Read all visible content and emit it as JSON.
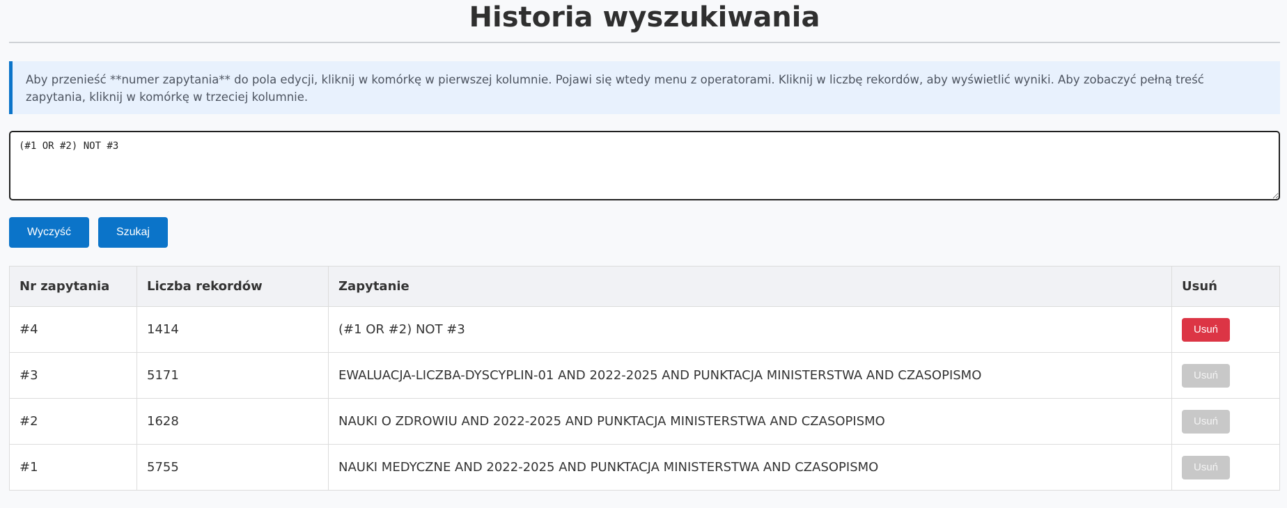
{
  "page": {
    "title": "Historia wyszukiwania",
    "info": "Aby przenieść **numer zapytania** do pola edycji, kliknij w komórkę w pierwszej kolumnie. Pojawi się wtedy menu z operatorami. Kliknij w liczbę rekordów, aby wyświetlić wyniki. Aby zobaczyć pełną treść zapytania, kliknij w komórkę w trzeciej kolumnie."
  },
  "editor": {
    "value": "(#1 OR #2) NOT #3"
  },
  "buttons": {
    "clear_label": "Wyczyść",
    "search_label": "Szukaj"
  },
  "table": {
    "headers": {
      "nr": "Nr zapytania",
      "count": "Liczba rekordów",
      "query": "Zapytanie",
      "delete": "Usuń"
    },
    "rows": [
      {
        "nr": "#4",
        "count": "1414",
        "query": "(#1 OR #2) NOT #3",
        "delete_label": "Usuń",
        "delete_enabled": true
      },
      {
        "nr": "#3",
        "count": "5171",
        "query": "EWALUACJA-LICZBA-DYSCYPLIN-01 AND 2022-2025 AND PUNKTACJA MINISTERSTWA AND CZASOPISMO",
        "delete_label": "Usuń",
        "delete_enabled": false
      },
      {
        "nr": "#2",
        "count": "1628",
        "query": "NAUKI O ZDROWIU AND 2022-2025 AND PUNKTACJA MINISTERSTWA AND CZASOPISMO",
        "delete_label": "Usuń",
        "delete_enabled": false
      },
      {
        "nr": "#1",
        "count": "5755",
        "query": "NAUKI MEDYCZNE AND 2022-2025 AND PUNKTACJA MINISTERSTWA AND CZASOPISMO",
        "delete_label": "Usuń",
        "delete_enabled": false
      }
    ]
  },
  "colors": {
    "primary": "#0b74c9",
    "danger": "#dc3545",
    "disabled": "#c8c8c8",
    "info_bg": "#e8f1fd"
  }
}
